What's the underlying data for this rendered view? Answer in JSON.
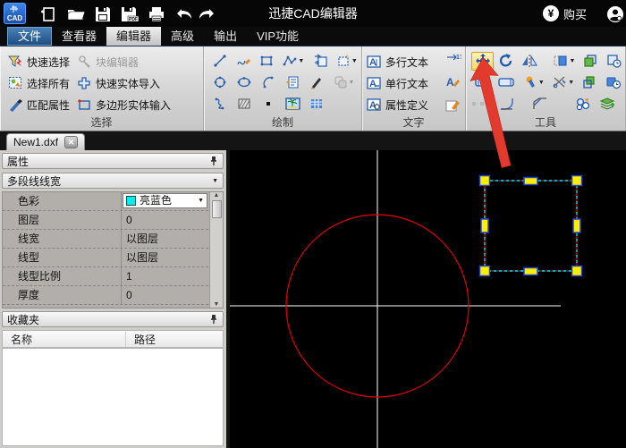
{
  "window": {
    "title": "迅捷CAD编辑器",
    "logo_text": "CAD",
    "buy_label": "购买"
  },
  "menu": {
    "items": [
      {
        "label": "文件"
      },
      {
        "label": "查看器"
      },
      {
        "label": "编辑器"
      },
      {
        "label": "高级"
      },
      {
        "label": "输出"
      },
      {
        "label": "VIP功能"
      }
    ]
  },
  "ribbon": {
    "select": {
      "label": "选择",
      "quick_select": "快速选择",
      "block_editor": "块编辑器",
      "select_all": "选择所有",
      "quick_entity_import": "快速实体导入",
      "match_properties": "匹配属性",
      "polygon_entity_input": "多边形实体输入"
    },
    "draw": {
      "label": "绘制"
    },
    "text": {
      "label": "文字",
      "multiline": "多行文本",
      "singleline": "单行文本",
      "attribute_def": "属性定义"
    },
    "tools": {
      "label": "工具"
    }
  },
  "tabs": {
    "active": "New1.dxf"
  },
  "properties": {
    "title": "属性",
    "selector": "多段线线宽",
    "rows": [
      {
        "label": "色彩",
        "value": "亮蓝色"
      },
      {
        "label": "图层",
        "value": "0"
      },
      {
        "label": "线宽",
        "value": "以图层"
      },
      {
        "label": "线型",
        "value": "以图层"
      },
      {
        "label": "线型比例",
        "value": "1"
      },
      {
        "label": "厚度",
        "value": "0"
      }
    ]
  },
  "favorites": {
    "title": "收藏夹",
    "name_col": "名称",
    "path_col": "路径"
  },
  "colors": {
    "entity_red": "#e00000",
    "crosshair_white": "#ffffff",
    "grip_fill": "#ffee00",
    "grip_border": "#2244cc",
    "selection_cyan": "#00e5ff",
    "selection_red": "#d00000",
    "color_swatch": "#00f0f0",
    "move_highlight": "#ffd95e",
    "annotation_arrow": "#e23b2e",
    "accent_blue": "#2a5fad"
  }
}
